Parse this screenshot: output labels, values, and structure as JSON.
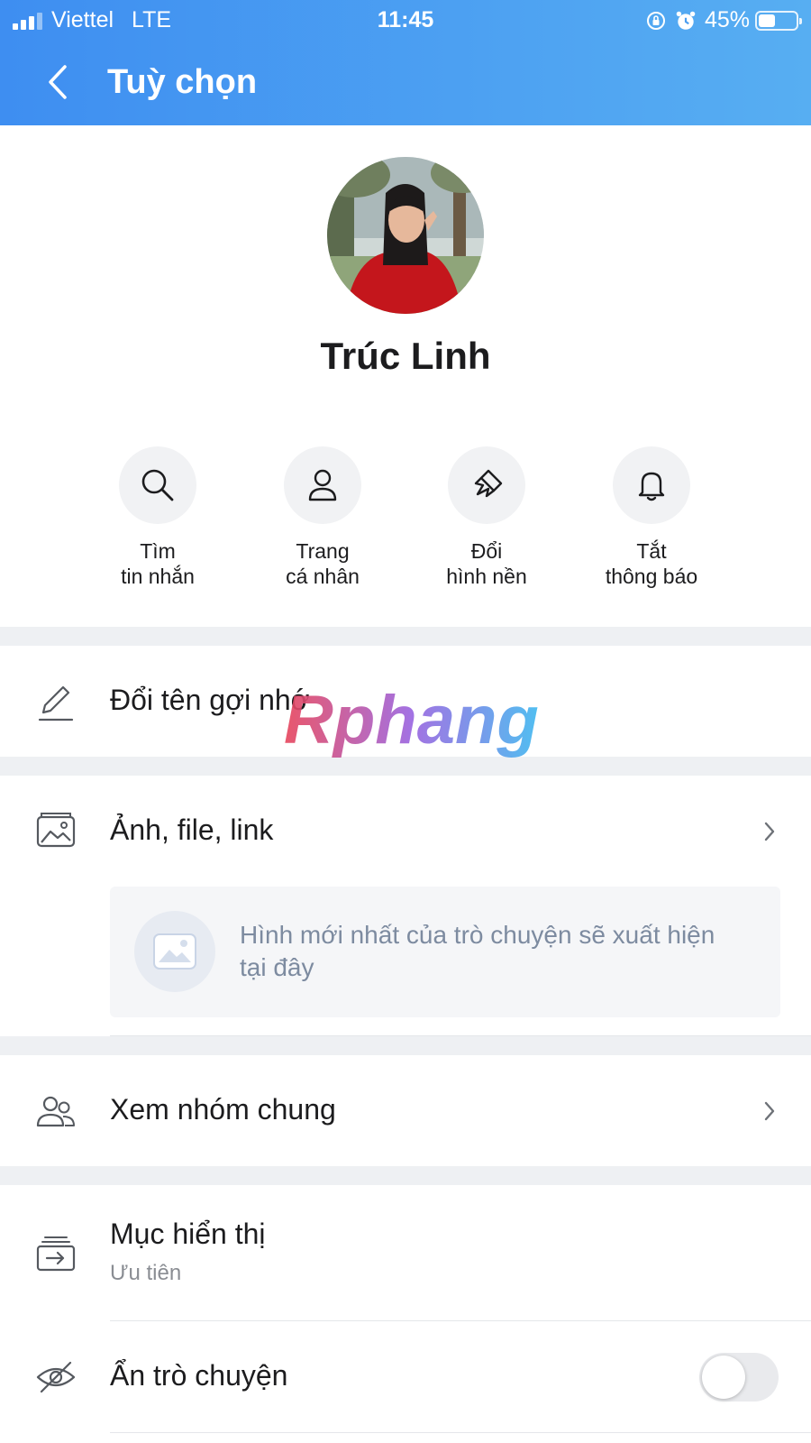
{
  "status_bar": {
    "carrier": "Viettel",
    "network": "LTE",
    "time": "11:45",
    "battery_percent": "45%",
    "battery_level": 0.45
  },
  "header": {
    "title": "Tuỳ chọn"
  },
  "profile": {
    "name": "Trúc Linh"
  },
  "actions": [
    {
      "line1": "Tìm",
      "line2": "tin nhắn",
      "icon": "search-icon"
    },
    {
      "line1": "Trang",
      "line2": "cá nhân",
      "icon": "user-icon"
    },
    {
      "line1": "Đổi",
      "line2": "hình nền",
      "icon": "paintbrush-icon"
    },
    {
      "line1": "Tắt",
      "line2": "thông báo",
      "icon": "bell-icon"
    }
  ],
  "rows": {
    "rename": "Đổi tên gợi nhớ",
    "media": "Ảnh, file, link",
    "media_empty": "Hình mới nhất của trò chuyện sẽ xuất hiện tại đây",
    "groups": "Xem nhóm chung",
    "display": "Mục hiển thị",
    "display_value": "Ưu tiên",
    "hide": "Ẩn trò chuyện"
  },
  "watermark": {
    "text": "Rphang"
  },
  "colors": {
    "header_start": "#3e8ef1",
    "header_end": "#57aef2",
    "divider": "#eef0f3"
  }
}
